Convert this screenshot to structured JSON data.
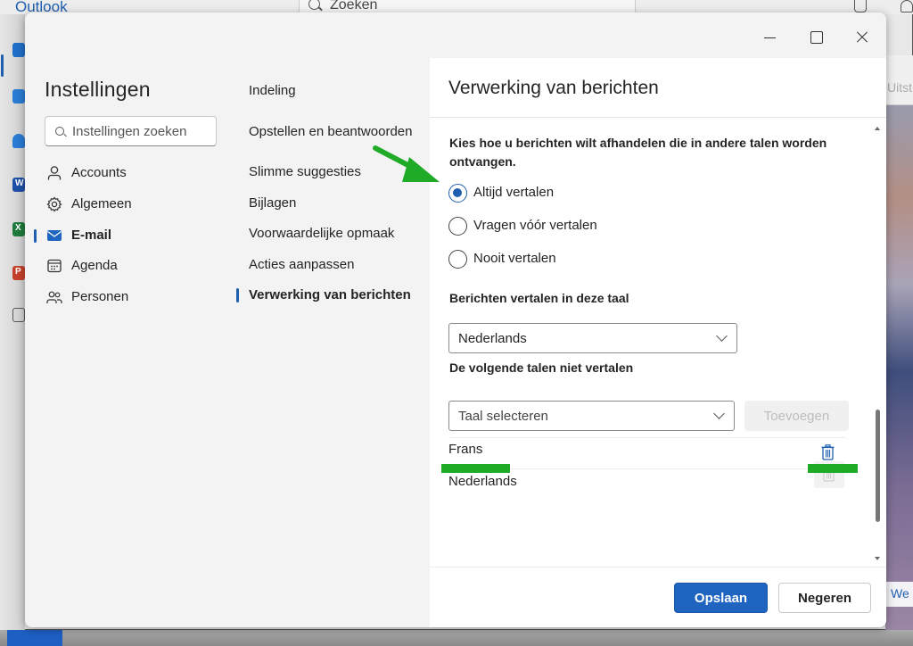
{
  "background_app": {
    "title": "Outlook",
    "search_placeholder": "Zoeken",
    "right_peek_text": "Uitst",
    "right_peek_bottom_text": "We",
    "rail_icons": [
      {
        "name": "mail-icon",
        "color": "#1f6fc7"
      },
      {
        "name": "calendar-icon",
        "color": "#1f6fc7"
      },
      {
        "name": "people-icon",
        "color": "#1f6fc7"
      },
      {
        "name": "word-icon",
        "color": "#1e4fa6",
        "letter": "W"
      },
      {
        "name": "excel-icon",
        "color": "#1e7a3c",
        "letter": "X"
      },
      {
        "name": "powerpoint-icon",
        "color": "#c5402a",
        "letter": "P"
      },
      {
        "name": "apps-icon",
        "color": "#555555"
      }
    ]
  },
  "dialog": {
    "window_controls": {
      "minimize": "minimize",
      "maximize": "maximize",
      "close": "close"
    },
    "settings_title": "Instellingen",
    "search_placeholder": "Instellingen zoeken",
    "nav": [
      {
        "label": "Accounts",
        "icon": "person-icon",
        "active": false
      },
      {
        "label": "Algemeen",
        "icon": "gear-icon",
        "active": false
      },
      {
        "label": "E-mail",
        "icon": "mail-icon",
        "active": true
      },
      {
        "label": "Agenda",
        "icon": "calendar-icon",
        "active": false
      },
      {
        "label": "Personen",
        "icon": "people-icon",
        "active": false
      }
    ],
    "subnav": [
      {
        "label": "Indeling",
        "active": false
      },
      {
        "label": "Opstellen en beantwoorden",
        "active": false
      },
      {
        "label": "Slimme suggesties",
        "active": false
      },
      {
        "label": "Bijlagen",
        "active": false
      },
      {
        "label": "Voorwaardelijke opmaak",
        "active": false
      },
      {
        "label": "Acties aanpassen",
        "active": false
      },
      {
        "label": "Verwerking van berichten",
        "active": true
      }
    ],
    "panel": {
      "title": "Verwerking van berichten",
      "question": "Kies hoe u berichten wilt afhandelen die in andere talen worden ontvangen.",
      "radio_options": [
        {
          "label": "Altijd vertalen",
          "checked": true
        },
        {
          "label": "Vragen vóór vertalen",
          "checked": false
        },
        {
          "label": "Nooit vertalen",
          "checked": false
        }
      ],
      "translate_to_label": "Berichten vertalen in deze taal",
      "translate_to_value": "Nederlands",
      "no_translate_label": "De volgende talen niet vertalen",
      "no_translate_select_placeholder": "Taal selecteren",
      "add_button": "Toevoegen",
      "excluded_languages": [
        {
          "name": "Frans",
          "delete_enabled": true
        },
        {
          "name": "Nederlands",
          "delete_enabled": false
        }
      ],
      "save_button": "Opslaan",
      "cancel_button": "Negeren"
    }
  },
  "colors": {
    "accent": "#1f64c0",
    "annotation_green": "#1faa27"
  }
}
